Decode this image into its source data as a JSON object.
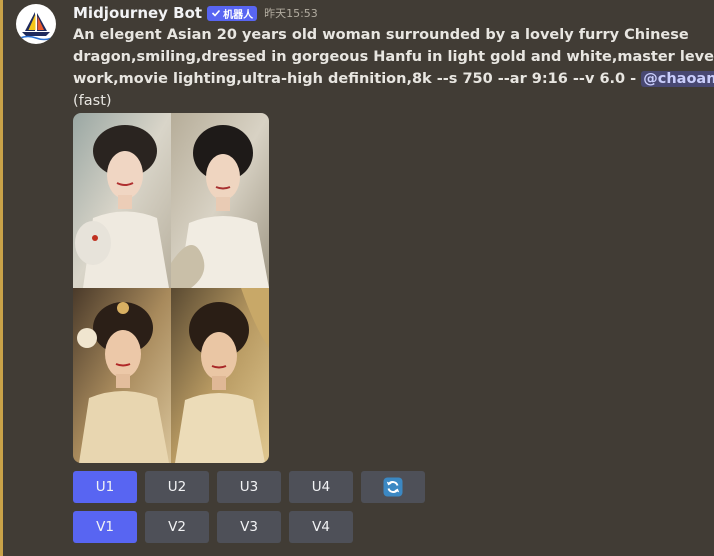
{
  "message": {
    "username": "Midjourney Bot",
    "app_tag": "机器人",
    "timestamp": "昨天15:53",
    "prompt_line1": "An elegent Asian 20 years old woman surrounded by a lovely furry Chinese",
    "prompt_line2": "dragon,smiling,dressed in gorgeous Hanfu in light gold and white,master level",
    "prompt_line3": "work,movie lighting,ultra-high definition,8k --s 750 --ar 9:16 --v 6.0 - ",
    "mention": "@chaoanan",
    "mode": "(fast)"
  },
  "buttons": {
    "upscale": [
      "U1",
      "U2",
      "U3",
      "U4"
    ],
    "variation": [
      "V1",
      "V2",
      "V3",
      "V4"
    ]
  },
  "icons": {
    "avatar": "sailboat-icon",
    "tag_check": "checkmark-icon",
    "reroll": "refresh-icon"
  },
  "colors": {
    "background": "#413c35",
    "primary_button": "#5865f2",
    "secondary_button": "#4e5058",
    "mention_text": "#c9cdfb"
  }
}
